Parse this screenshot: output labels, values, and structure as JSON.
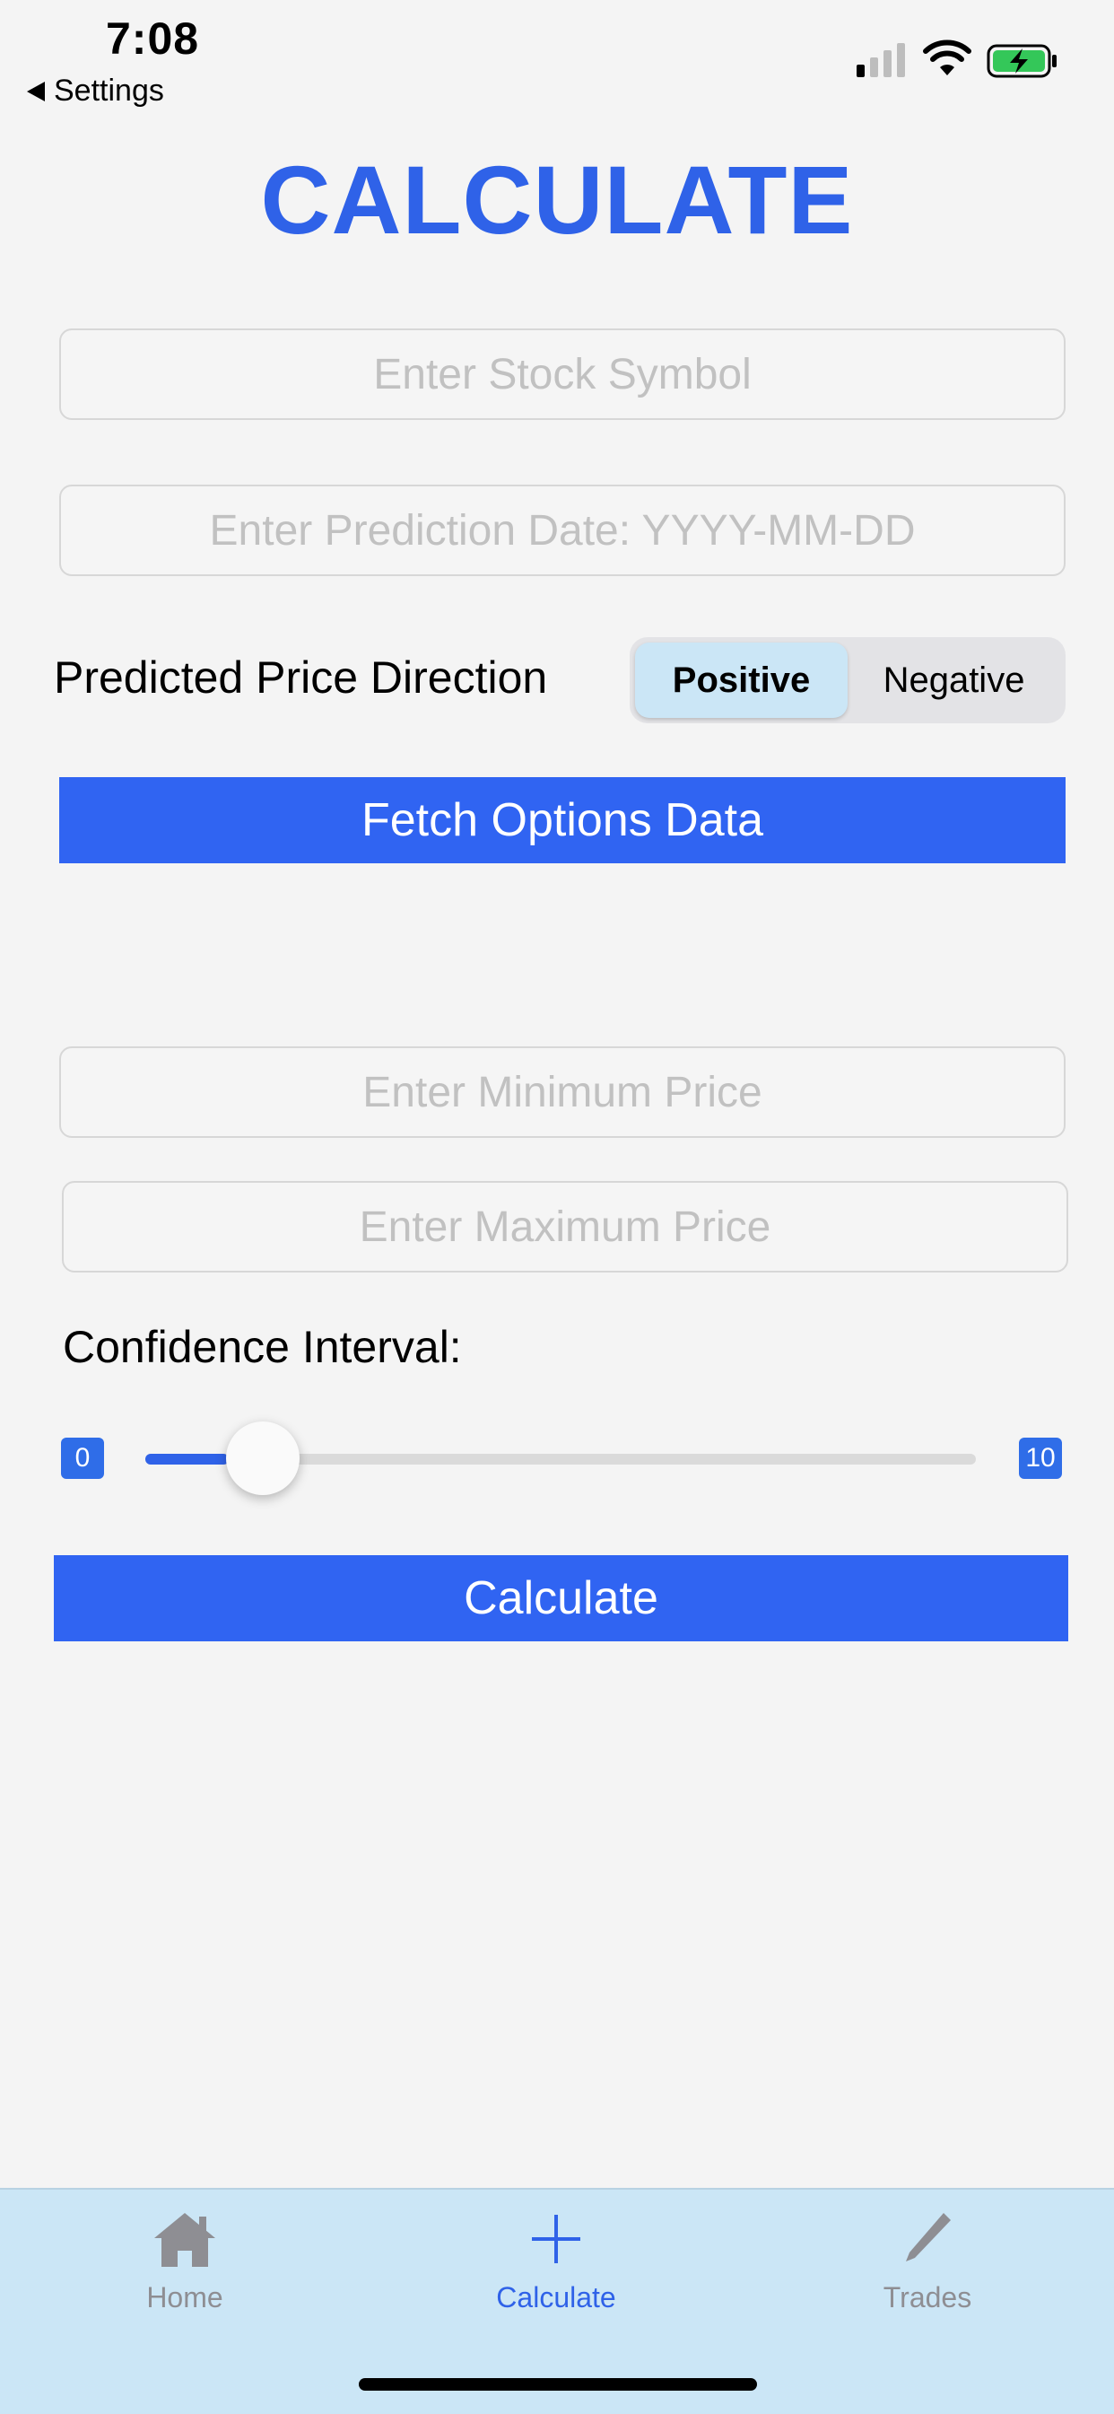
{
  "status_bar": {
    "time": "7:08",
    "back_label": "Settings"
  },
  "page": {
    "title": "CALCULATE"
  },
  "stock_symbol": {
    "value": "",
    "placeholder": "Enter Stock Symbol"
  },
  "prediction_date": {
    "value": "",
    "placeholder": "Enter Prediction Date: YYYY-MM-DD"
  },
  "direction": {
    "label": "Predicted Price Direction",
    "options": [
      "Positive",
      "Negative"
    ],
    "selected": "Positive"
  },
  "fetch_button": {
    "label": "Fetch Options Data"
  },
  "min_price": {
    "value": "",
    "placeholder": "Enter Minimum Price"
  },
  "max_price": {
    "value": "",
    "placeholder": "Enter Maximum Price"
  },
  "confidence": {
    "label": "Confidence Interval:",
    "min_label": "0",
    "max_label": "10",
    "min": 0,
    "max": 10,
    "value": 1
  },
  "calculate_button": {
    "label": "Calculate"
  },
  "tabbar": {
    "items": [
      {
        "label": "Home",
        "icon": "house-icon",
        "active": false
      },
      {
        "label": "Calculate",
        "icon": "plus-icon",
        "active": true
      },
      {
        "label": "Trades",
        "icon": "pencil-icon",
        "active": false
      }
    ],
    "active_color": "#2f62e8",
    "inactive_color": "#8e8e93"
  },
  "colors": {
    "accent": "#2f62e8",
    "button": "#3064f2",
    "tabbar_bg": "#cbe6f6"
  }
}
